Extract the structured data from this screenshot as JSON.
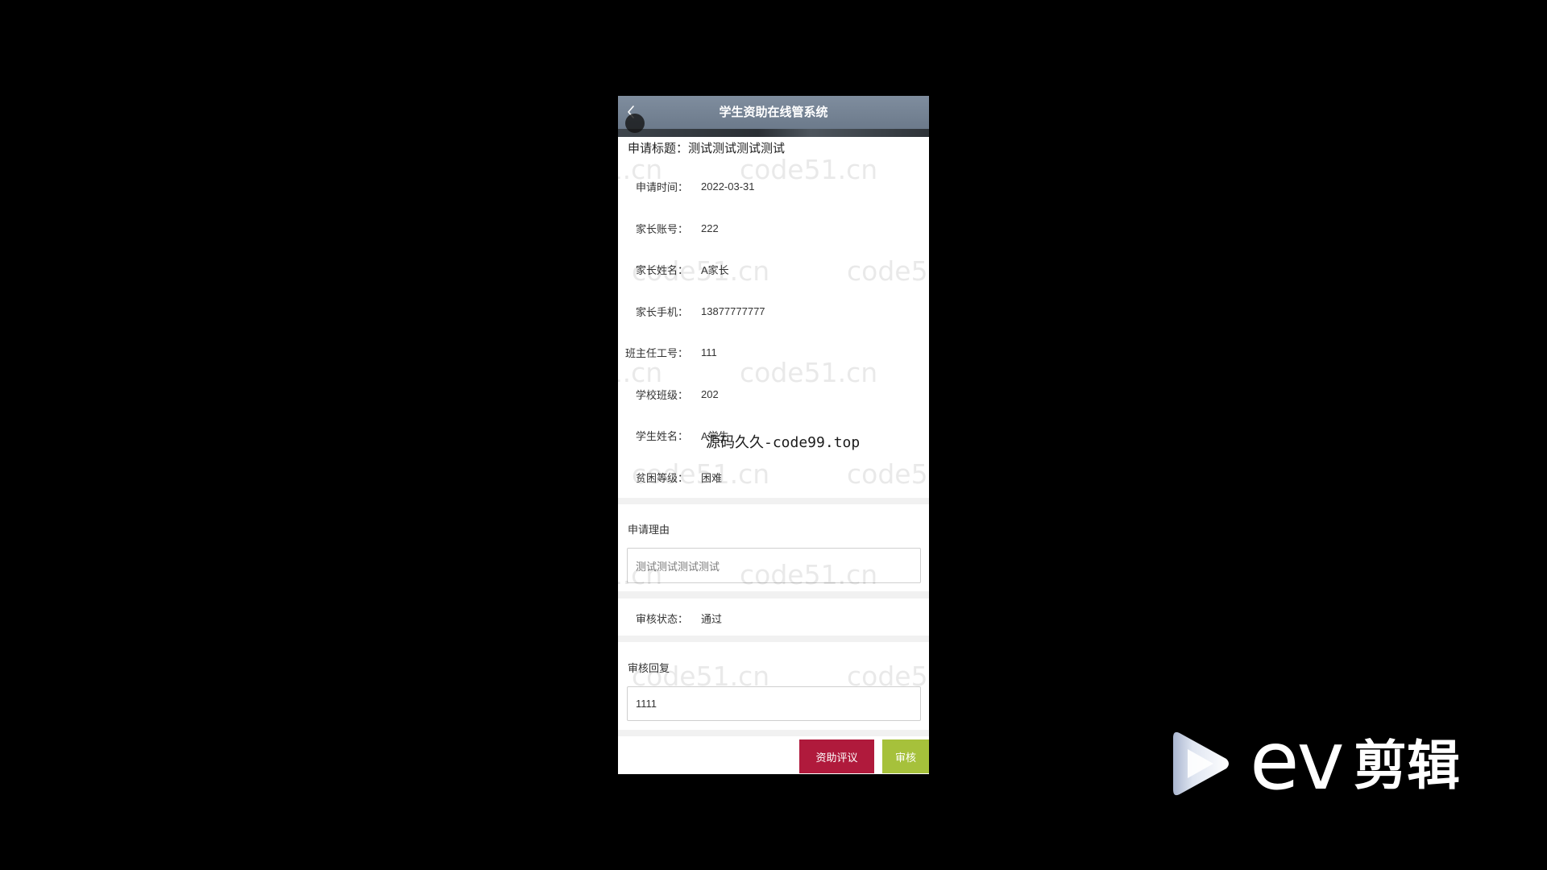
{
  "header": {
    "title": "学生资助在线管系统",
    "back_icon": "chevron-left-icon"
  },
  "application": {
    "title_label": "申请标题：",
    "title_value": "测试测试测试测试",
    "fields": [
      {
        "label": "申请时间：",
        "value": "2022-03-31"
      },
      {
        "label": "家长账号：",
        "value": "222"
      },
      {
        "label": "家长姓名：",
        "value": "A家长"
      },
      {
        "label": "家长手机：",
        "value": "13877777777"
      },
      {
        "label": "班主任工号：",
        "value": "111"
      },
      {
        "label": "学校班级：",
        "value": "202"
      },
      {
        "label": "学生姓名：",
        "value": "A学生"
      },
      {
        "label": "贫困等级：",
        "value": "困难"
      }
    ],
    "reason": {
      "label": "申请理由",
      "value": "测试测试测试测试"
    },
    "review_status": {
      "label": "审核状态：",
      "value": "通过"
    },
    "review_reply": {
      "label": "审核回复",
      "value": "1111"
    }
  },
  "actions": {
    "evaluate_label": "资助评议",
    "review_label": "审核"
  },
  "watermarks": {
    "site": "code51.cn",
    "overlay": "源码久久-code99.top"
  },
  "logo": {
    "icon": "play-icon",
    "latin": "ev",
    "cjk": "剪辑"
  },
  "colors": {
    "background": "#000000",
    "header": "#74839a",
    "evaluate_button": "#b01a3c",
    "review_button": "#a6c13b"
  }
}
